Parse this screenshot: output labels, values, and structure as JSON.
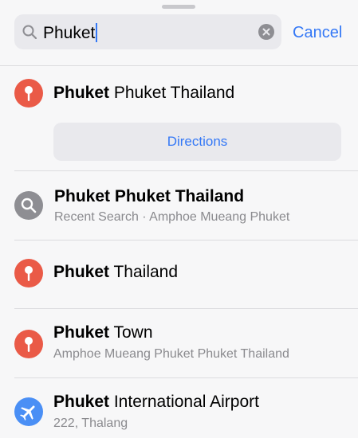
{
  "search": {
    "query": "Phuket",
    "cancel_label": "Cancel"
  },
  "results": [
    {
      "icon": "location-pin-icon",
      "icon_color": "#ea5a47",
      "title_bold": "Phuket",
      "title_rest": " Phuket Thailand",
      "action_label": "Directions"
    },
    {
      "icon": "search-icon",
      "icon_color": "#8e8e93",
      "title_bold": "Phuket Phuket Thailand",
      "title_rest": "",
      "subtitle": "Recent Search · Amphoe Mueang Phuket"
    },
    {
      "icon": "location-pin-icon",
      "icon_color": "#ea5a47",
      "title_bold": "Phuket",
      "title_rest": " Thailand"
    },
    {
      "icon": "location-pin-icon",
      "icon_color": "#ea5a47",
      "title_bold": "Phuket",
      "title_rest": " Town",
      "subtitle": "Amphoe Mueang Phuket Phuket Thailand"
    },
    {
      "icon": "airplane-icon",
      "icon_color": "#4a8ff5",
      "title_bold": "Phuket",
      "title_rest": " International Airport",
      "subtitle": "222, Thalang"
    }
  ],
  "colors": {
    "accent": "#3478f6",
    "pin": "#ea5a47",
    "search_badge": "#8e8e93",
    "airport_badge": "#4a8ff5",
    "secondary_text": "#8a8a8e"
  }
}
